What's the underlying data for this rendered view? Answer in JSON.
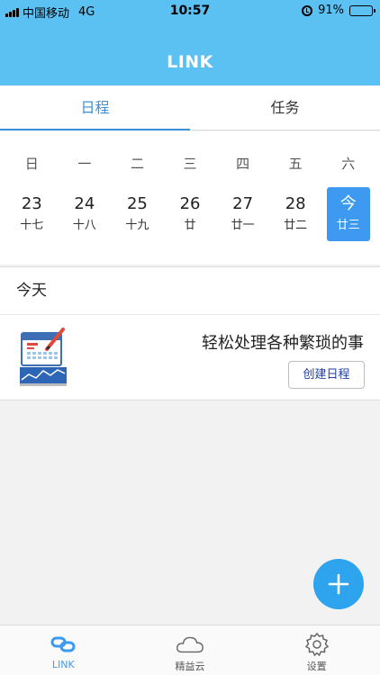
{
  "status_bar": {
    "carrier": "中国移动",
    "network": "4G",
    "time": "10:57",
    "battery": "91%",
    "battery_level": 0.91
  },
  "header": {
    "title": "LINK"
  },
  "tabs": [
    {
      "label": "日程",
      "active": true
    },
    {
      "label": "任务",
      "active": false
    }
  ],
  "calendar": {
    "weekdays": [
      "日",
      "一",
      "二",
      "三",
      "四",
      "五",
      "六"
    ],
    "days": [
      {
        "num": "23",
        "lunar": "十七"
      },
      {
        "num": "24",
        "lunar": "十八"
      },
      {
        "num": "25",
        "lunar": "十九"
      },
      {
        "num": "26",
        "lunar": "廿"
      },
      {
        "num": "27",
        "lunar": "廿一"
      },
      {
        "num": "28",
        "lunar": "廿二"
      },
      {
        "num": "今",
        "lunar": "廿三",
        "today": true
      }
    ]
  },
  "today": {
    "heading": "今天",
    "empty_text": "轻松处理各种繁琐的事",
    "create_button": "创建日程"
  },
  "bottom_nav": [
    {
      "label": "LINK",
      "icon": "link-icon",
      "active": true
    },
    {
      "label": "精益云",
      "icon": "cloud-icon",
      "active": false
    },
    {
      "label": "设置",
      "icon": "gear-icon",
      "active": false
    }
  ],
  "colors": {
    "header": "#5bc0f2",
    "accent": "#3d9af0",
    "fab": "#2fa4ee"
  }
}
